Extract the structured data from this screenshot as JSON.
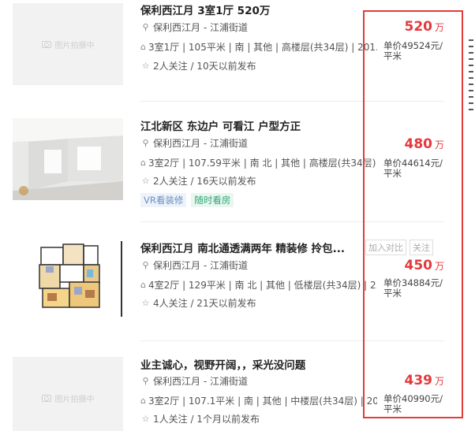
{
  "listings": [
    {
      "title": "保利西江月 3室1厅 520万",
      "location": "保利西江月 - 江浦街道",
      "info": "3室1厅 | 105平米 | 南 | 其他 | 高楼层(共34层) | 201...",
      "follow": "2人关注 / 10天以前发布",
      "price": "520",
      "price_unit": "万",
      "unit_price": "单价49524元/平米",
      "image_placeholder": "图片拍摄中",
      "tags": []
    },
    {
      "title": "江北新区 东边户 可看江 户型方正",
      "location": "保利西江月 - 江浦街道",
      "info": "3室2厅 | 107.59平米 | 南 北 | 其他 | 高楼层(共34层) | ...",
      "follow": "2人关注 / 16天以前发布",
      "price": "480",
      "price_unit": "万",
      "unit_price": "单价44614元/平米",
      "tags": [
        "VR看装修",
        "随时看房"
      ]
    },
    {
      "title": "保利西江月 南北通透满两年 精装修 拎包...",
      "location": "保利西江月 - 江浦街道",
      "info": "4室2厅 | 129平米 | 南 北 | 其他 | 低楼层(共34层) | 2...",
      "follow": "4人关注 / 21天以前发布",
      "price": "450",
      "price_unit": "万",
      "unit_price": "单价34884元/平米",
      "actions": [
        "加入对比",
        "关注"
      ],
      "tags": []
    },
    {
      "title": "业主诚心，视野开阔，，采光没问题",
      "location": "保利西江月 - 江浦街道",
      "info": "3室2厅 | 107.1平米 | 南 | 其他 | 中楼层(共34层) | 20...",
      "follow": "1人关注 / 1个月以前发布",
      "price": "439",
      "price_unit": "万",
      "unit_price": "单价40990元/平米",
      "image_placeholder": "图片拍摄中",
      "tags": []
    }
  ],
  "icons": {
    "location": "location-pin-icon",
    "info": "house-icon",
    "follow": "star-icon"
  },
  "colors": {
    "price": "#e4393c",
    "highlight_box": "#e23b3b",
    "tag_vr": "#6c8fbf",
    "tag_see": "#2fa476"
  }
}
